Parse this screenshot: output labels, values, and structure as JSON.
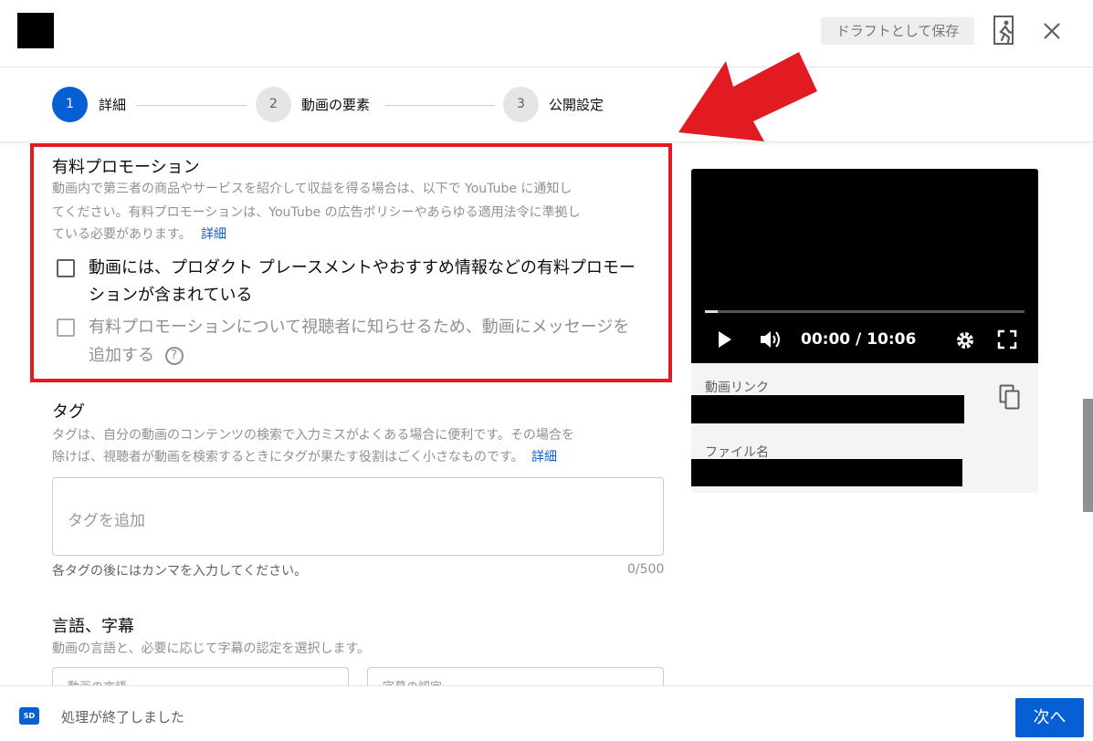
{
  "header": {
    "draft_label": "ドラフトとして保存"
  },
  "stepper": {
    "steps": [
      {
        "number": "1",
        "label": "詳細"
      },
      {
        "number": "2",
        "label": "動画の要素"
      },
      {
        "number": "3",
        "label": "公開設定"
      }
    ]
  },
  "promotion": {
    "title": "有料プロモーション",
    "desc_line1": "動画内で第三者の商品やサービスを紹介して収益を得る場合は、以下で YouTube に通知し",
    "desc_line2": "てください。有料プロモーションは、YouTube の広告ポリシーやあらゆる適用法令に準拠し",
    "desc_line3": "ている必要があります。",
    "more_link": "詳細",
    "checkbox1_line1": "動画には、プロダクト プレースメントやおすすめ情報などの有料プロモー",
    "checkbox1_line2": "ションが含まれている",
    "checkbox2_line1": "有料プロモーションについて視聴者に知らせるため、動画にメッセージを",
    "checkbox2_line2": "追加する",
    "help_glyph": "?"
  },
  "tags": {
    "title": "タグ",
    "desc_line1": "タグは、自分の動画のコンテンツの検索で入力ミスがよくある場合に便利です。その場合を",
    "desc_line2": "除けば、視聴者が動画を検索するときにタグが果たす役割はごく小さなものです。",
    "more_link": "詳細",
    "placeholder": "タグを追加",
    "hint": "各タグの後にはカンマを入力してください。",
    "counter": "0/500"
  },
  "language": {
    "title": "言語、字幕",
    "desc": "動画の言語と、必要に応じて字幕の認定を選択します。",
    "video_language_label": "動画の言語",
    "caption_cert_label": "字幕の認定"
  },
  "video": {
    "time": "00:00 / 10:06",
    "progress_fraction": 0.04,
    "link_label": "動画リンク",
    "filename_label": "ファイル名"
  },
  "footer": {
    "badge": "SD",
    "status": "処理が終了しました",
    "next_label": "次へ"
  },
  "colors": {
    "accent": "#065fd4",
    "highlight": "#e21b23"
  },
  "icons": {
    "exit": "exit-icon",
    "close": "close-icon",
    "play": "play-icon",
    "volume": "volume-icon",
    "settings": "gear-icon",
    "fullscreen": "fullscreen-icon",
    "copy": "copy-icon",
    "help": "help-icon"
  }
}
